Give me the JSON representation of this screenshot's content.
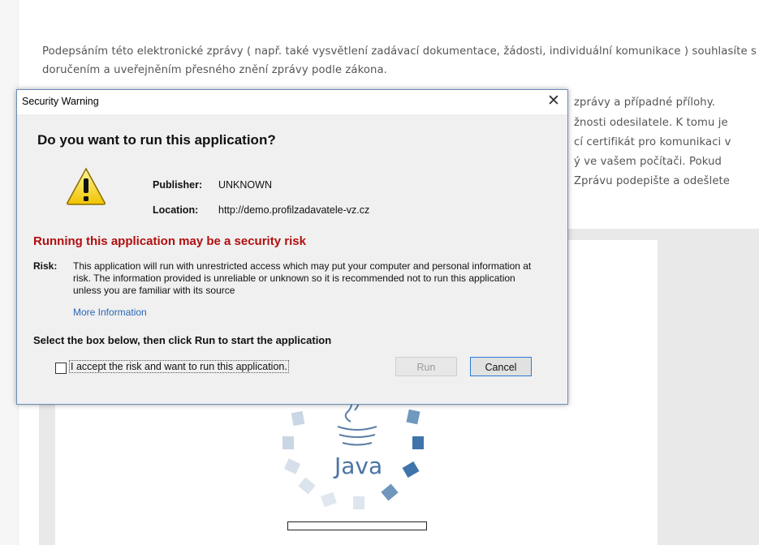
{
  "page": {
    "para1": "Podepsáním této elektronické zprávy ( např. také vysvětlení zadávací dokumentace, žádosti, individuální komunikace ) souhlasíte s doručením a uveřejněním přesného znění zprávy podle zákona.",
    "para2_lines": [
      "zprávy a případné přílohy.",
      "žnosti odesilatele. K tomu je",
      "cí certifikát pro komunikaci v",
      "ý ve vašem počítači. Pokud",
      "Zprávu podepište a odešlete"
    ],
    "java_logo_text": "Java"
  },
  "dialog": {
    "title": "Security Warning",
    "close_symbol": "✕",
    "heading": "Do you want to run this application?",
    "publisher_label": "Publisher:",
    "publisher_value": "UNKNOWN",
    "location_label": "Location:",
    "location_value": "http://demo.profilzadavatele-vz.cz",
    "risk_heading": "Running this application may be a security risk",
    "risk_label": "Risk:",
    "risk_text": "This application will run with unrestricted access which may put your computer and personal information at risk. The information provided is unreliable or unknown so it is recommended not to run this application unless you are familiar with its source",
    "more_info": "More Information",
    "select_instruction": "Select the box below, then click Run to start the application",
    "checkbox_label": "I accept the risk and want to run this application.",
    "checkbox_checked": false,
    "run_label": "Run",
    "cancel_label": "Cancel",
    "icon": "warning-icon",
    "colors": {
      "risk": "#b10e0e",
      "link": "#2a66b6",
      "focus": "#2a7bd4"
    }
  }
}
